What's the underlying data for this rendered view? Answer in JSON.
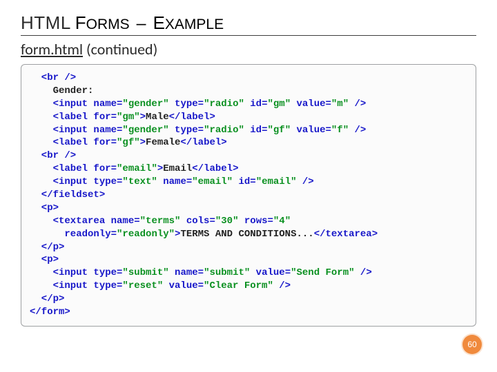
{
  "heading": {
    "word1": "HTML",
    "word2_big": "F",
    "word2_rest": "ORMS",
    "dash": "–",
    "word3_big": "E",
    "word3_rest": "XAMPLE"
  },
  "subtitle": {
    "filename": "form.html",
    "rest": " (continued)"
  },
  "code": {
    "l1": "  <br />",
    "l2": "    Gender:",
    "l3a": "    <input name=",
    "l3b": "\"gender\"",
    "l3c": " type=",
    "l3d": "\"radio\"",
    "l3e": " id=",
    "l3f": "\"gm\"",
    "l3g": " value=",
    "l3h": "\"m\"",
    "l3i": " />",
    "l4a": "    <label for=",
    "l4b": "\"gm\"",
    "l4c": ">",
    "l4d": "Male",
    "l4e": "</label>",
    "l5a": "    <input name=",
    "l5b": "\"gender\"",
    "l5c": " type=",
    "l5d": "\"radio\"",
    "l5e": " id=",
    "l5f": "\"gf\"",
    "l5g": " value=",
    "l5h": "\"f\"",
    "l5i": " />",
    "l6a": "    <label for=",
    "l6b": "\"gf\"",
    "l6c": ">",
    "l6d": "Female",
    "l6e": "</label>",
    "l7": "  <br />",
    "l8a": "    <label for=",
    "l8b": "\"email\"",
    "l8c": ">",
    "l8d": "Email",
    "l8e": "</label>",
    "l9a": "    <input type=",
    "l9b": "\"text\"",
    "l9c": " name=",
    "l9d": "\"email\"",
    "l9e": " id=",
    "l9f": "\"email\"",
    "l9g": " />",
    "l10": "  </fieldset>",
    "l11": "  <p>",
    "l12a": "    <textarea name=",
    "l12b": "\"terms\"",
    "l12c": " cols=",
    "l12d": "\"30\"",
    "l12e": " rows=",
    "l12f": "\"4\"",
    "l13a": "      readonly=",
    "l13b": "\"readonly\"",
    "l13c": ">",
    "l13d": "TERMS AND CONDITIONS...",
    "l13e": "</textarea>",
    "l14": "  </p>",
    "l15": "  <p>",
    "l16a": "    <input type=",
    "l16b": "\"submit\"",
    "l16c": " name=",
    "l16d": "\"submit\"",
    "l16e": " value=",
    "l16f": "\"Send Form\"",
    "l16g": " />",
    "l17a": "    <input type=",
    "l17b": "\"reset\"",
    "l17c": " value=",
    "l17d": "\"Clear Form\"",
    "l17e": " />",
    "l18": "  </p>",
    "l19": "</form>"
  },
  "page_number": "60"
}
